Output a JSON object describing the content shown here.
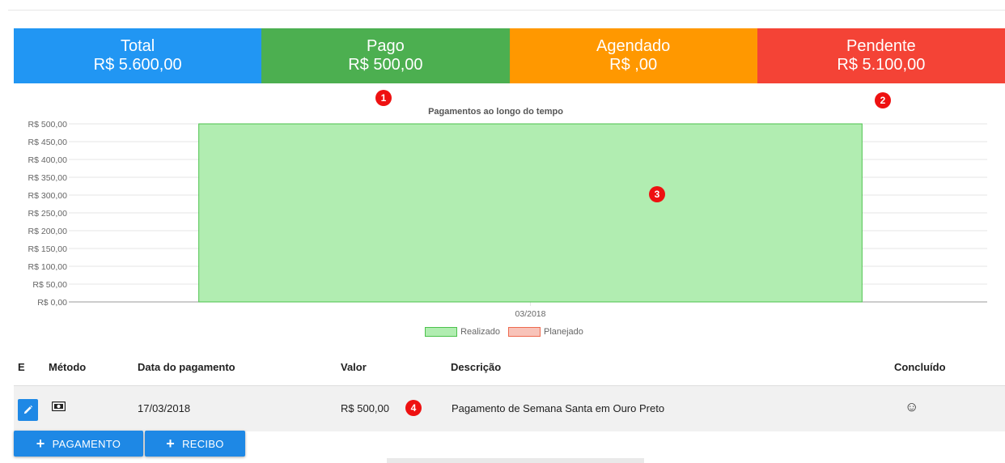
{
  "summary": {
    "cards": [
      {
        "title": "Total",
        "value": "R$ 5.600,00",
        "color": "#2196f3"
      },
      {
        "title": "Pago",
        "value": "R$ 500,00",
        "color": "#4caf50"
      },
      {
        "title": "Agendado",
        "value": "R$ ,00",
        "color": "#ff9800"
      },
      {
        "title": "Pendente",
        "value": "R$ 5.100,00",
        "color": "#f44336"
      }
    ]
  },
  "annotations": [
    "1",
    "2",
    "3",
    "4"
  ],
  "chart_data": {
    "type": "bar",
    "title": "Pagamentos ao longo do tempo",
    "categories": [
      "03/2018"
    ],
    "series": [
      {
        "name": "Realizado",
        "values": [
          500
        ],
        "fill": "#b1edb1",
        "stroke": "#4cc24c"
      },
      {
        "name": "Planejado",
        "values": [
          0
        ],
        "fill": "#f8c3b9",
        "stroke": "#ee6a4f"
      }
    ],
    "yticks": [
      "R$ 0,00",
      "R$ 50,00",
      "R$ 100,00",
      "R$ 150,00",
      "R$ 200,00",
      "R$ 250,00",
      "R$ 300,00",
      "R$ 350,00",
      "R$ 400,00",
      "R$ 450,00",
      "R$ 500,00"
    ],
    "ylim": [
      0,
      500
    ],
    "grid": true,
    "legend": "bottom"
  },
  "table": {
    "headers": {
      "e": "E",
      "method": "Método",
      "date": "Data do pagamento",
      "value": "Valor",
      "description": "Descrição",
      "done": "Concluído"
    },
    "rows": [
      {
        "method_icon": "cash-icon",
        "date": "17/03/2018",
        "value": "R$ 500,00",
        "description": "Pagamento de Semana Santa em Ouro Preto",
        "done": "☺"
      }
    ]
  },
  "buttons": {
    "pagamento": "PAGAMENTO",
    "recibo": "RECIBO"
  }
}
